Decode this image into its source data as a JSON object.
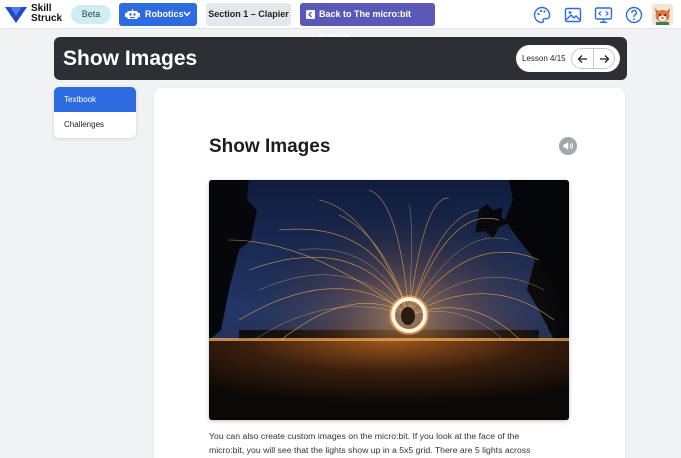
{
  "topbar": {
    "brand_line1": "Skill",
    "brand_line2": "Struck",
    "beta_label": "Beta",
    "course_label": "Robotics",
    "section_label": "Section 1 – Clapier",
    "back_label": "Back to The micro:bit Python",
    "icons": [
      "palette-icon",
      "image-gallery-icon",
      "code-display-icon",
      "help-icon",
      "fox-avatar-icon"
    ],
    "colors": {
      "primary": "#2d6be0",
      "back": "#5b59b8",
      "beta": "#cfeef3"
    }
  },
  "titlebar": {
    "title": "Show Images",
    "lesson_label": "Lesson 4/15"
  },
  "sidetabs": {
    "items": [
      {
        "label": "Textbook",
        "active": true
      },
      {
        "label": "Challenges",
        "active": false
      }
    ]
  },
  "content": {
    "heading": "Show Images",
    "paragraph_lines": [
      "You can also create custom images on the micro:bit.   If you look at the face of the",
      "micro:bit, you will see that the lights show up in a 5x5 grid.  There are 5 lights across"
    ]
  }
}
